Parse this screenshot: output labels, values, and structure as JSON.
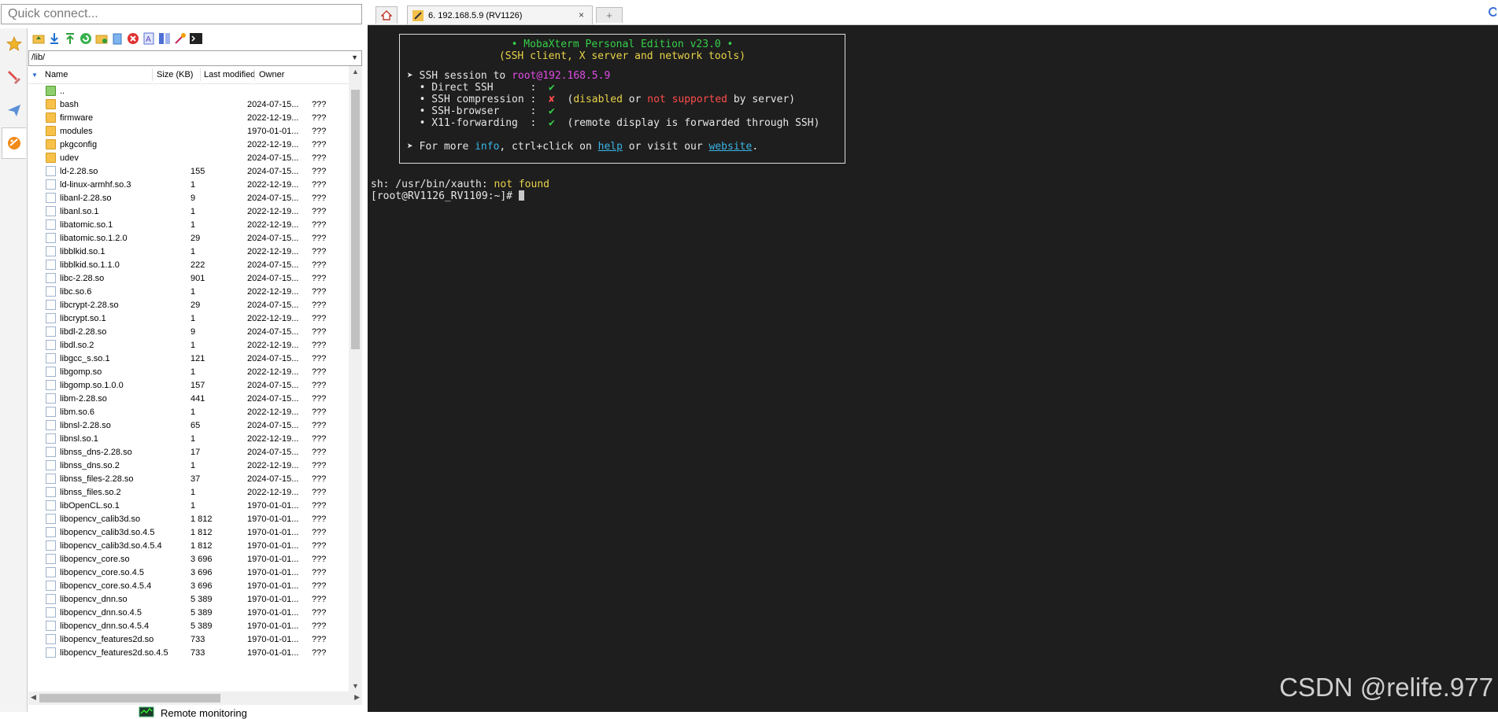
{
  "quick_connect": {
    "placeholder": "Quick connect..."
  },
  "sidebar": {
    "icons": [
      "star-icon",
      "tools-icon",
      "send-icon",
      "sftp-icon"
    ]
  },
  "sftp": {
    "path": "/lib/",
    "columns": {
      "name": "Name",
      "size": "Size (KB)",
      "modified": "Last modified",
      "owner": "Owner"
    },
    "rows": [
      {
        "name": "..",
        "size": "",
        "date": "",
        "owner": "",
        "type": "up"
      },
      {
        "name": "bash",
        "size": "",
        "date": "2024-07-15...",
        "owner": "???",
        "type": "folder"
      },
      {
        "name": "firmware",
        "size": "",
        "date": "2022-12-19...",
        "owner": "???",
        "type": "folder"
      },
      {
        "name": "modules",
        "size": "",
        "date": "1970-01-01...",
        "owner": "???",
        "type": "folder"
      },
      {
        "name": "pkgconfig",
        "size": "",
        "date": "2022-12-19...",
        "owner": "???",
        "type": "folder"
      },
      {
        "name": "udev",
        "size": "",
        "date": "2024-07-15...",
        "owner": "???",
        "type": "folder"
      },
      {
        "name": "ld-2.28.so",
        "size": "155",
        "date": "2024-07-15...",
        "owner": "???",
        "type": "file"
      },
      {
        "name": "ld-linux-armhf.so.3",
        "size": "1",
        "date": "2022-12-19...",
        "owner": "???",
        "type": "file"
      },
      {
        "name": "libanl-2.28.so",
        "size": "9",
        "date": "2024-07-15...",
        "owner": "???",
        "type": "file"
      },
      {
        "name": "libanl.so.1",
        "size": "1",
        "date": "2022-12-19...",
        "owner": "???",
        "type": "file"
      },
      {
        "name": "libatomic.so.1",
        "size": "1",
        "date": "2022-12-19...",
        "owner": "???",
        "type": "file"
      },
      {
        "name": "libatomic.so.1.2.0",
        "size": "29",
        "date": "2024-07-15...",
        "owner": "???",
        "type": "file"
      },
      {
        "name": "libblkid.so.1",
        "size": "1",
        "date": "2022-12-19...",
        "owner": "???",
        "type": "file"
      },
      {
        "name": "libblkid.so.1.1.0",
        "size": "222",
        "date": "2024-07-15...",
        "owner": "???",
        "type": "file"
      },
      {
        "name": "libc-2.28.so",
        "size": "901",
        "date": "2024-07-15...",
        "owner": "???",
        "type": "file"
      },
      {
        "name": "libc.so.6",
        "size": "1",
        "date": "2022-12-19...",
        "owner": "???",
        "type": "file"
      },
      {
        "name": "libcrypt-2.28.so",
        "size": "29",
        "date": "2024-07-15...",
        "owner": "???",
        "type": "file"
      },
      {
        "name": "libcrypt.so.1",
        "size": "1",
        "date": "2022-12-19...",
        "owner": "???",
        "type": "file"
      },
      {
        "name": "libdl-2.28.so",
        "size": "9",
        "date": "2024-07-15...",
        "owner": "???",
        "type": "file"
      },
      {
        "name": "libdl.so.2",
        "size": "1",
        "date": "2022-12-19...",
        "owner": "???",
        "type": "file"
      },
      {
        "name": "libgcc_s.so.1",
        "size": "121",
        "date": "2024-07-15...",
        "owner": "???",
        "type": "file"
      },
      {
        "name": "libgomp.so",
        "size": "1",
        "date": "2022-12-19...",
        "owner": "???",
        "type": "file"
      },
      {
        "name": "libgomp.so.1.0.0",
        "size": "157",
        "date": "2024-07-15...",
        "owner": "???",
        "type": "file"
      },
      {
        "name": "libm-2.28.so",
        "size": "441",
        "date": "2024-07-15...",
        "owner": "???",
        "type": "file"
      },
      {
        "name": "libm.so.6",
        "size": "1",
        "date": "2022-12-19...",
        "owner": "???",
        "type": "file"
      },
      {
        "name": "libnsl-2.28.so",
        "size": "65",
        "date": "2024-07-15...",
        "owner": "???",
        "type": "file"
      },
      {
        "name": "libnsl.so.1",
        "size": "1",
        "date": "2022-12-19...",
        "owner": "???",
        "type": "file"
      },
      {
        "name": "libnss_dns-2.28.so",
        "size": "17",
        "date": "2024-07-15...",
        "owner": "???",
        "type": "file"
      },
      {
        "name": "libnss_dns.so.2",
        "size": "1",
        "date": "2022-12-19...",
        "owner": "???",
        "type": "file"
      },
      {
        "name": "libnss_files-2.28.so",
        "size": "37",
        "date": "2024-07-15...",
        "owner": "???",
        "type": "file"
      },
      {
        "name": "libnss_files.so.2",
        "size": "1",
        "date": "2022-12-19...",
        "owner": "???",
        "type": "file"
      },
      {
        "name": "libOpenCL.so.1",
        "size": "1",
        "date": "1970-01-01...",
        "owner": "???",
        "type": "file"
      },
      {
        "name": "libopencv_calib3d.so",
        "size": "1 812",
        "date": "1970-01-01...",
        "owner": "???",
        "type": "file"
      },
      {
        "name": "libopencv_calib3d.so.4.5",
        "size": "1 812",
        "date": "1970-01-01...",
        "owner": "???",
        "type": "file"
      },
      {
        "name": "libopencv_calib3d.so.4.5.4",
        "size": "1 812",
        "date": "1970-01-01...",
        "owner": "???",
        "type": "file"
      },
      {
        "name": "libopencv_core.so",
        "size": "3 696",
        "date": "1970-01-01...",
        "owner": "???",
        "type": "file"
      },
      {
        "name": "libopencv_core.so.4.5",
        "size": "3 696",
        "date": "1970-01-01...",
        "owner": "???",
        "type": "file"
      },
      {
        "name": "libopencv_core.so.4.5.4",
        "size": "3 696",
        "date": "1970-01-01...",
        "owner": "???",
        "type": "file"
      },
      {
        "name": "libopencv_dnn.so",
        "size": "5 389",
        "date": "1970-01-01...",
        "owner": "???",
        "type": "file"
      },
      {
        "name": "libopencv_dnn.so.4.5",
        "size": "5 389",
        "date": "1970-01-01...",
        "owner": "???",
        "type": "file"
      },
      {
        "name": "libopencv_dnn.so.4.5.4",
        "size": "5 389",
        "date": "1970-01-01...",
        "owner": "???",
        "type": "file"
      },
      {
        "name": "libopencv_features2d.so",
        "size": "733",
        "date": "1970-01-01...",
        "owner": "???",
        "type": "file"
      },
      {
        "name": "libopencv_features2d.so.4.5",
        "size": "733",
        "date": "1970-01-01...",
        "owner": "???",
        "type": "file"
      }
    ],
    "remote_monitoring": "Remote monitoring"
  },
  "tabs": {
    "session_label": "6. 192.168.5.9 (RV1126)",
    "close": "×",
    "new_tab": "+"
  },
  "terminal": {
    "banner_title": "• MobaXterm Personal Edition v23.0 •",
    "banner_sub": "(SSH client, X server and network tools)",
    "ssh_session_prefix": "➤ SSH session to ",
    "ssh_session_host": "root@192.168.5.9",
    "direct_ssh": "  • Direct SSH      :  ",
    "direct_ssh_val": "✔",
    "ssh_comp": "  • SSH compression :  ",
    "ssh_comp_val": "✘",
    "ssh_comp_p1": "  (",
    "ssh_comp_disabled": "disabled",
    "ssh_comp_or": " or ",
    "ssh_comp_ns": "not supported",
    "ssh_comp_tail": " by server)",
    "ssh_browser": "  • SSH-browser     :  ",
    "ssh_browser_val": "✔",
    "x11": "  • X11-forwarding  :  ",
    "x11_val": "✔",
    "x11_tail": "  (remote display is forwarded through SSH)",
    "more_prefix": "➤ For more ",
    "more_info": "info",
    "more_mid": ", ctrl+click on ",
    "more_help": "help",
    "more_mid2": " or visit our ",
    "more_site": "website",
    "more_end": ".",
    "xauth_prefix": "sh: /usr/bin/xauth: ",
    "xauth_msg": "not found",
    "prompt": "[root@RV1126_RV1109:~]# "
  },
  "watermark": "CSDN @relife.977",
  "colors": {
    "terminal_bg": "#1e1e1e",
    "green": "#35d04a",
    "yellow": "#e8d34a",
    "red": "#ff4c4c",
    "magenta": "#e04ce6",
    "link": "#39b6e6"
  }
}
